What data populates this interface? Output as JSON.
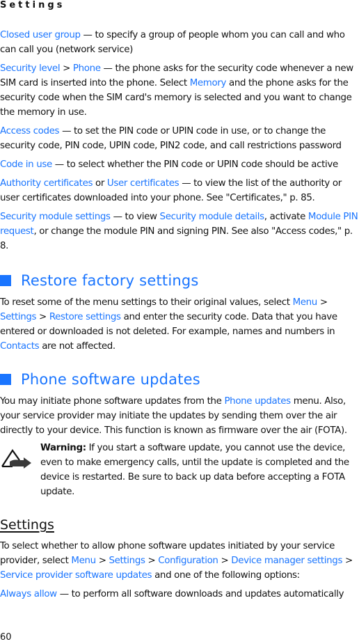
{
  "header": {
    "section_title": "Settings"
  },
  "security_options": [
    {
      "parts": [
        {
          "t": "Closed user group",
          "link": true
        },
        {
          "t": " — to specify a group of people whom you can call and who can call you (network service)"
        }
      ]
    },
    {
      "parts": [
        {
          "t": "Security level",
          "link": true
        },
        {
          "t": " > "
        },
        {
          "t": "Phone",
          "link": true
        },
        {
          "t": " — the phone asks for the security code whenever a new SIM card is inserted into the phone. Select "
        },
        {
          "t": "Memory",
          "link": true
        },
        {
          "t": " and the phone asks for the security code when the SIM card's memory is selected and you want to change the memory in use."
        }
      ]
    },
    {
      "parts": [
        {
          "t": "Access codes",
          "link": true
        },
        {
          "t": " — to set the PIN code or UPIN code in use, or to change the security code, PIN code, UPIN code, PIN2 code, and call restrictions password"
        }
      ]
    },
    {
      "parts": [
        {
          "t": "Code in use",
          "link": true
        },
        {
          "t": " — to select whether the PIN code or UPIN code should be active"
        }
      ]
    },
    {
      "parts": [
        {
          "t": "Authority certificates",
          "link": true
        },
        {
          "t": " or "
        },
        {
          "t": "User certificates",
          "link": true
        },
        {
          "t": " — to view the list of the authority or user certificates downloaded into your phone. See \"Certificates,\" p. 85."
        }
      ]
    },
    {
      "parts": [
        {
          "t": "Security module settings",
          "link": true
        },
        {
          "t": " — to view "
        },
        {
          "t": "Security module details",
          "link": true
        },
        {
          "t": ", activate "
        },
        {
          "t": "Module PIN request",
          "link": true
        },
        {
          "t": ", or change the module PIN and signing PIN. See also \"Access codes,\" p. 8."
        }
      ]
    }
  ],
  "restore": {
    "heading": "Restore factory settings",
    "body": [
      {
        "t": "To reset some of the menu settings to their original values, select "
      },
      {
        "t": "Menu",
        "link": true
      },
      {
        "t": " > "
      },
      {
        "t": "Settings",
        "link": true
      },
      {
        "t": " > "
      },
      {
        "t": "Restore settings",
        "link": true
      },
      {
        "t": " and enter the security code. Data that you have entered or downloaded is not deleted. For example, names and numbers in "
      },
      {
        "t": "Contacts",
        "link": true
      },
      {
        "t": " are not affected."
      }
    ]
  },
  "updates": {
    "heading": "Phone software updates",
    "body": [
      {
        "t": "You may initiate phone software updates from the "
      },
      {
        "t": "Phone updates",
        "link": true
      },
      {
        "t": " menu. Also, your service provider may initiate the updates by sending them over the air directly to your device. This function is known as firmware over the air (FOTA)."
      }
    ],
    "warning_label": "Warning:",
    "warning_text": " If you start a software update, you cannot use the device, even to make emergency calls, until the update is completed and the device is restarted. Be sure to back up data before accepting a FOTA update."
  },
  "settings_sub": {
    "heading": "Settings",
    "body": [
      {
        "t": "To select whether to allow phone software updates initiated by your service provider, select "
      },
      {
        "t": "Menu",
        "link": true
      },
      {
        "t": " > "
      },
      {
        "t": "Settings",
        "link": true
      },
      {
        "t": " > "
      },
      {
        "t": "Configuration",
        "link": true
      },
      {
        "t": " > "
      },
      {
        "t": "Device manager settings",
        "link": true
      },
      {
        "t": " > "
      },
      {
        "t": "Service provider software updates",
        "link": true
      },
      {
        "t": " and one of the following options:"
      }
    ],
    "options": [
      {
        "parts": [
          {
            "t": "Always allow",
            "link": true
          },
          {
            "t": " — to perform all software downloads and updates automatically"
          }
        ]
      }
    ]
  },
  "footer": {
    "page_number": "60"
  },
  "colors": {
    "link": "#1a75ff",
    "text": "#111111"
  }
}
